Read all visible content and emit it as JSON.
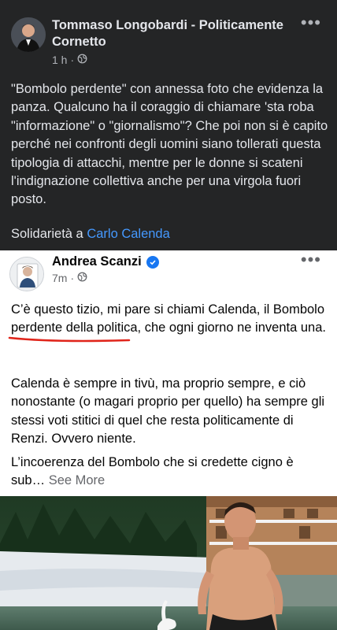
{
  "outer_post": {
    "author": "Tommaso Longobardi - Politicamente Cornetto",
    "time": "1 h",
    "separator": "·",
    "body_text": "\"Bombolo perdente\" con annessa foto che evidenza la panza. Qualcuno ha il coraggio di chiamare 'sta roba \"informazione\" o \"giornalismo\"? Che poi non si è capito perché nei confronti degli uomini siano tollerati questa tipologia di attacchi, mentre per le donne si scateni l'indignazione collettiva anche per una virgola fuori posto.",
    "solidarity_prefix": "Solidarietà a ",
    "solidarity_link": "Carlo Calenda",
    "link_color": "#4599ff"
  },
  "shared_post": {
    "author": "Andrea Scanzi",
    "verified_color": "#1877f2",
    "time": "7m",
    "separator": "·",
    "para1_before": "C’è questo tizio, mi pare si chiami Calenda, il ",
    "para1_highlight": "Bombolo perdente",
    "para1_after": " della politica, che ogni giorno ne inventa una.",
    "para2": "Calenda è sempre in tivù, ma proprio sempre, e ciò nonostante (o magari proprio per quello) ha sempre gli stessi voti stitici di quel che resta politicamente di Renzi. Ovvero niente.",
    "para3": "L’incoerenza del Bombolo che si credette cigno è sub…",
    "see_more": " See More",
    "underline_color": "#e0251b"
  },
  "icons": [
    "more-options-icon",
    "globe-icon",
    "verified-badge-icon"
  ]
}
